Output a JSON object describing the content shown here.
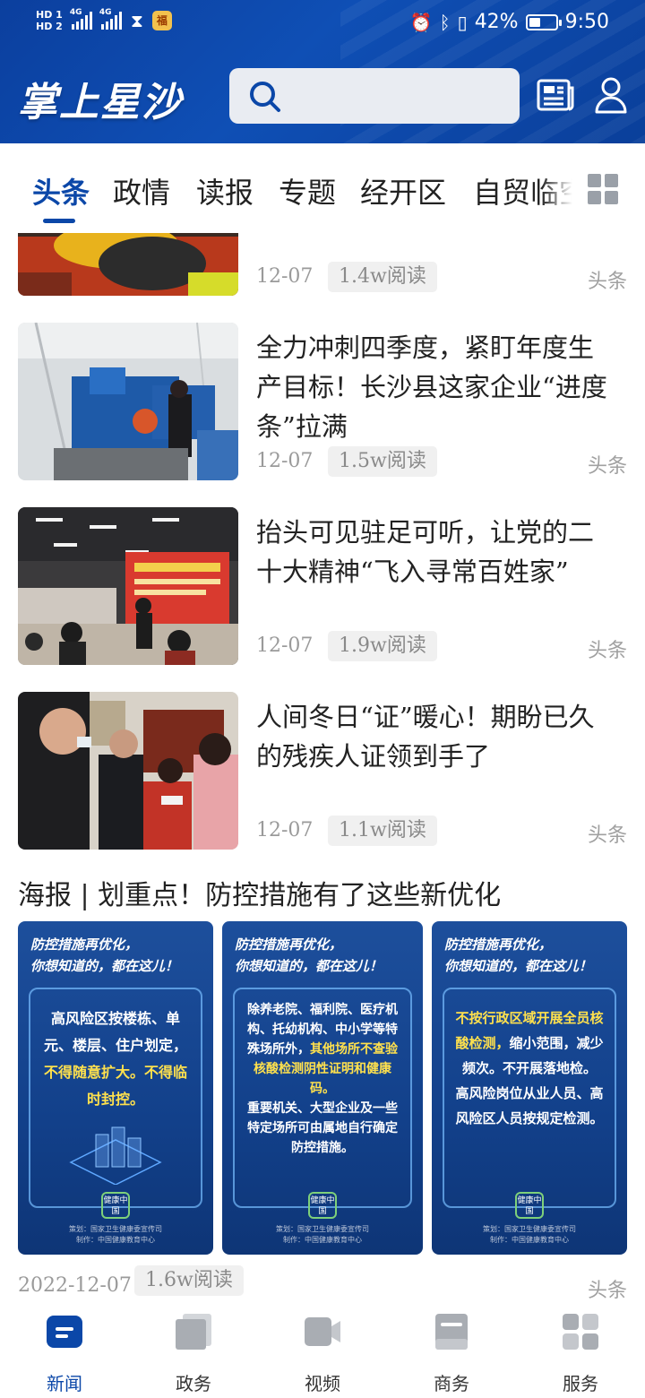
{
  "status_bar": {
    "hd1": "HD 1",
    "hd2": "HD 2",
    "net1": "4G",
    "net2": "4G",
    "battery_percent": "42%",
    "battery_level": 0.42,
    "time": "9:50"
  },
  "header": {
    "app_title": "掌上星沙",
    "search_placeholder": ""
  },
  "tabs": [
    {
      "label": "头条"
    },
    {
      "label": "政情"
    },
    {
      "label": "读报"
    },
    {
      "label": "专题"
    },
    {
      "label": "经开区"
    },
    {
      "label": "自贸临空"
    }
  ],
  "articles": [
    {
      "title": "",
      "date": "12-07",
      "reads": "1.4w阅读",
      "category": "头条"
    },
    {
      "title": "全力冲刺四季度，紧盯年度生产目标！长沙县这家企业“进度条”拉满",
      "date": "12-07",
      "reads": "1.5w阅读",
      "category": "头条"
    },
    {
      "title": "抬头可见驻足可听，让党的二十大精神“飞入寻常百姓家”",
      "date": "12-07",
      "reads": "1.9w阅读",
      "category": "头条"
    },
    {
      "title": "人间冬日“证”暖心！期盼已久的残疾人证领到手了",
      "date": "12-07",
      "reads": "1.1w阅读",
      "category": "头条"
    }
  ],
  "poster_article": {
    "title": "海报 | 划重点！防控措施有了这些新优化",
    "date": "2022-12-07",
    "reads": "1.6w阅读",
    "category": "头条",
    "posters": [
      {
        "head_line1": "防控措施再优化，",
        "head_line2": "你想知道的，都在这儿！",
        "body_white": "高风险区按楼栋、单元、楼层、住户划定，",
        "body_yellow": "不得随意扩大。不得临时封控。",
        "logo": "健康中国",
        "credit1": "策划：国家卫生健康委宣传司",
        "credit2": "制作：中国健康教育中心"
      },
      {
        "head_line1": "防控措施再优化，",
        "head_line2": "你想知道的，都在这儿！",
        "body_white": "除养老院、福利院、医疗机构、托幼机构、中小学等特殊场所外，",
        "body_yellow": "其他场所不查验核酸检测阴性证明和健康码。",
        "body_white2": "重要机关、大型企业及一些特定场所可由属地自行确定防控措施。",
        "logo": "健康中国",
        "credit1": "策划：国家卫生健康委宣传司",
        "credit2": "制作：中国健康教育中心"
      },
      {
        "head_line1": "防控措施再优化，",
        "head_line2": "你想知道的，都在这儿！",
        "body_yellow": "不按行政区域开展全员核酸检测，",
        "body_white": "缩小范围，减少频次。不开展落地检。",
        "body_white2": "高风险岗位从业人员、高风险区人员按规定检测。",
        "logo": "健康中国",
        "credit1": "策划：国家卫生健康委宣传司",
        "credit2": "制作：中国健康教育中心"
      }
    ]
  },
  "bottom_nav": [
    {
      "label": "新闻",
      "icon": "news-icon",
      "active": true
    },
    {
      "label": "政务",
      "icon": "government-icon",
      "active": false
    },
    {
      "label": "视频",
      "icon": "video-icon",
      "active": false
    },
    {
      "label": "商务",
      "icon": "business-icon",
      "active": false
    },
    {
      "label": "服务",
      "icon": "services-icon",
      "active": false
    }
  ],
  "colors": {
    "brand_blue": "#0b47a8",
    "header_blue": "#0f4fb5",
    "inactive_gray": "#a9adb3"
  }
}
